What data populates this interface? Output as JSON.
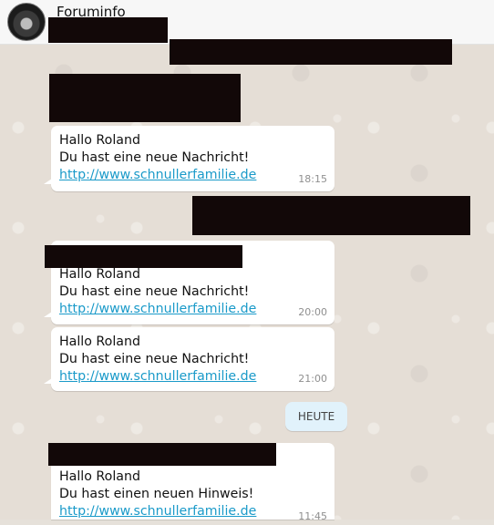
{
  "chat": {
    "contact_name": "Foruminfo",
    "day_separator": "HEUTE",
    "messages": [
      {
        "greeting": "Hallo Roland",
        "body": "Du hast eine neue Nachricht!",
        "link": "http://www.schnullerfamilie.de",
        "time": "18:15"
      },
      {
        "greeting": "Hallo Roland",
        "body": "Du hast eine neue Nachricht!",
        "link": "http://www.schnullerfamilie.de",
        "time": "20:00"
      },
      {
        "greeting": "Hallo Roland",
        "body": "Du hast eine neue Nachricht!",
        "link": "http://www.schnullerfamilie.de",
        "time": "21:00"
      },
      {
        "greeting": "Hallo Roland",
        "body": "Du hast einen neuen Hinweis!",
        "link": "http://www.schnullerfamilie.de",
        "time": "11:45"
      }
    ]
  },
  "icons": {
    "avatar": "avatar-photo"
  },
  "colors": {
    "link": "#1a9ac9",
    "redaction": "#120808",
    "day_badge": "#e1f2fb"
  }
}
